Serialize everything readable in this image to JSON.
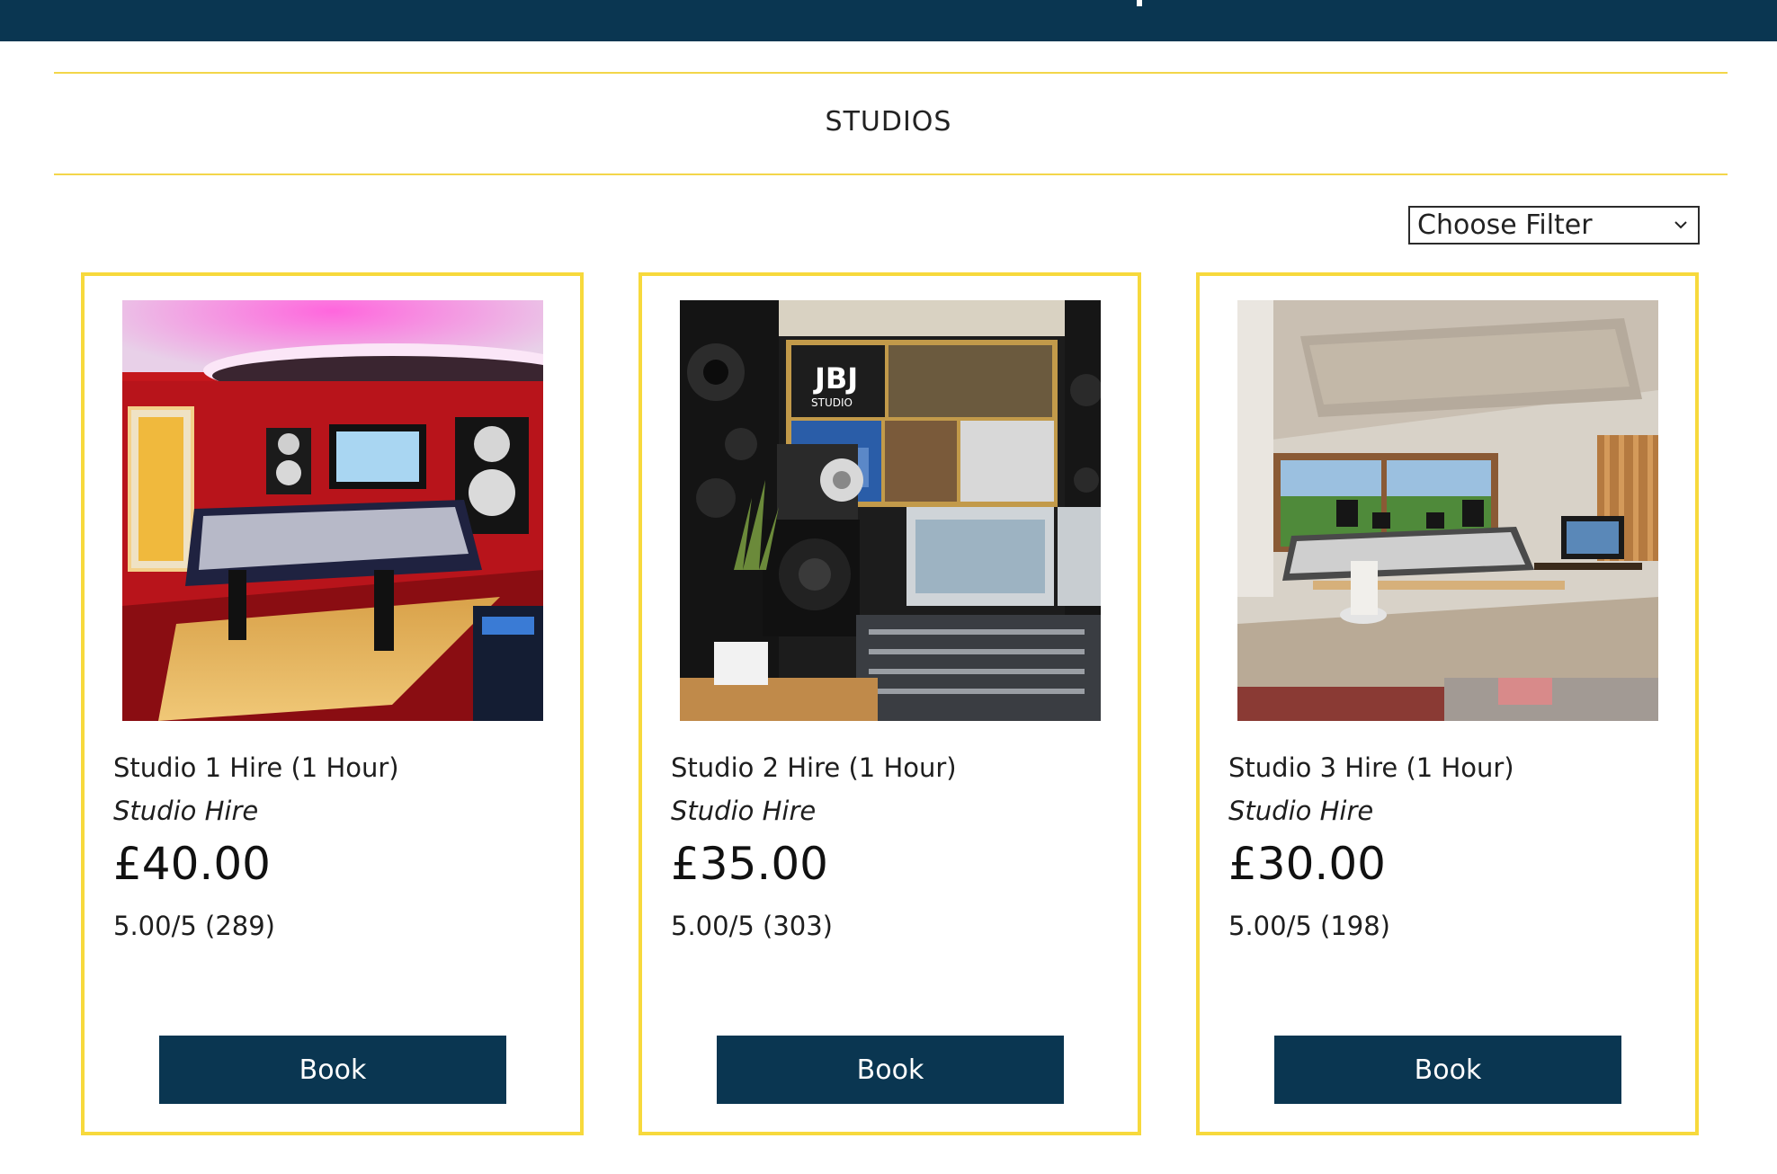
{
  "section": {
    "title": "STUDIOS"
  },
  "filter": {
    "selected": "Choose Filter"
  },
  "products": [
    {
      "name": "Studio 1 Hire (1 Hour)",
      "category": "Studio Hire",
      "price": "£40.00",
      "rating": "5.00/5 (289)",
      "book_label": "Book"
    },
    {
      "name": "Studio 2 Hire (1 Hour)",
      "category": "Studio Hire",
      "price": "£35.00",
      "rating": "5.00/5 (303)",
      "book_label": "Book"
    },
    {
      "name": "Studio 3 Hire (1 Hour)",
      "category": "Studio Hire",
      "price": "£30.00",
      "rating": "5.00/5 (198)",
      "book_label": "Book"
    }
  ],
  "photo_text": {
    "jbj_logo": "JBJ",
    "jbj_sub": "STUDIO"
  },
  "colors": {
    "brand_navy": "#0a3651",
    "accent_yellow": "#f7d93c"
  }
}
